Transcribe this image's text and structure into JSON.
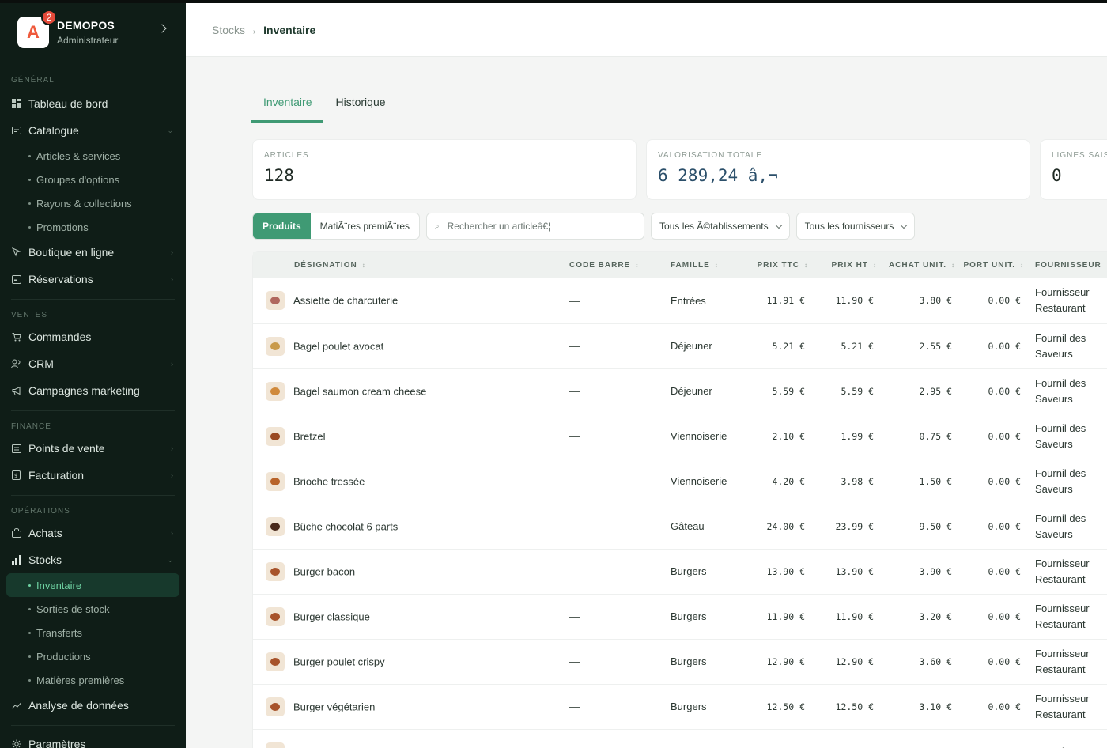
{
  "brand": {
    "letter": "A",
    "badge": "2",
    "name": "DEMOPOS",
    "role": "Administrateur"
  },
  "nav": {
    "general_title": "GÉNÉRAL",
    "dashboard": "Tableau de bord",
    "catalogue": "Catalogue",
    "catalogue_items": [
      "Articles & services",
      "Groupes d'options",
      "Rayons & collections",
      "Promotions"
    ],
    "boutique": "Boutique en ligne",
    "reservations": "Réservations",
    "ventes_title": "VENTES",
    "commandes": "Commandes",
    "crm": "CRM",
    "campagnes": "Campagnes marketing",
    "finance_title": "FINANCE",
    "points_vente": "Points de vente",
    "facturation": "Facturation",
    "operations_title": "OPÉRATIONS",
    "achats": "Achats",
    "stocks": "Stocks",
    "stocks_items": [
      "Inventaire",
      "Sorties de stock",
      "Transferts",
      "Productions",
      "Matières premières"
    ],
    "analyse": "Analyse de données",
    "parametres": "Paramètres"
  },
  "breadcrumb": {
    "parent": "Stocks",
    "separator": "›",
    "current": "Inventaire"
  },
  "tabs": [
    "Inventaire",
    "Historique"
  ],
  "cards": [
    {
      "label": "ARTICLES",
      "value": "128"
    },
    {
      "label": "VALORISATION TOTALE",
      "value": "6 289,24 â‚¬"
    },
    {
      "label": "LIGNES SAISIES",
      "value": "0"
    }
  ],
  "filters": {
    "seg_products": "Produits",
    "seg_raw": "MatiÃ¨res premiÃ¨res",
    "search_placeholder": "Rechercher un articleâ€¦",
    "establishments": "Tous les Ã©tablissements",
    "suppliers": "Tous les fournisseurs"
  },
  "table": {
    "headers": [
      "DÉSIGNATION",
      "CODE BARRE",
      "FAMILLE",
      "PRIX TTC",
      "PRIX HT",
      "ACHAT UNIT.",
      "PORT UNIT.",
      "FOURNISSEUR"
    ],
    "rows": [
      {
        "name": "Assiette de charcuterie",
        "barcode": "—",
        "family": "Entrées",
        "ttc": "11.91 €",
        "ht": "11.90 €",
        "achat": "3.80 €",
        "port": "0.00 €",
        "supplier": "Fournisseur Restaurant",
        "thumb": "#b0675d"
      },
      {
        "name": "Bagel poulet avocat",
        "barcode": "—",
        "family": "Déjeuner",
        "ttc": "5.21 €",
        "ht": "5.21 €",
        "achat": "2.55 €",
        "port": "0.00 €",
        "supplier": "Fournil des Saveurs",
        "thumb": "#c99a4a"
      },
      {
        "name": "Bagel saumon cream cheese",
        "barcode": "—",
        "family": "Déjeuner",
        "ttc": "5.59 €",
        "ht": "5.59 €",
        "achat": "2.95 €",
        "port": "0.00 €",
        "supplier": "Fournil des Saveurs",
        "thumb": "#d08a3c"
      },
      {
        "name": "Bretzel",
        "barcode": "—",
        "family": "Viennoiserie",
        "ttc": "2.10 €",
        "ht": "1.99 €",
        "achat": "0.75 €",
        "port": "0.00 €",
        "supplier": "Fournil des Saveurs",
        "thumb": "#9a4a22"
      },
      {
        "name": "Brioche tressée",
        "barcode": "—",
        "family": "Viennoiserie",
        "ttc": "4.20 €",
        "ht": "3.98 €",
        "achat": "1.50 €",
        "port": "0.00 €",
        "supplier": "Fournil des Saveurs",
        "thumb": "#b8632a"
      },
      {
        "name": "Bûche chocolat 6 parts",
        "barcode": "—",
        "family": "Gâteau",
        "ttc": "24.00 €",
        "ht": "23.99 €",
        "achat": "9.50 €",
        "port": "0.00 €",
        "supplier": "Fournil des Saveurs",
        "thumb": "#4a2a1c"
      },
      {
        "name": "Burger bacon",
        "barcode": "—",
        "family": "Burgers",
        "ttc": "13.90 €",
        "ht": "13.90 €",
        "achat": "3.90 €",
        "port": "0.00 €",
        "supplier": "Fournisseur Restaurant",
        "thumb": "#a7532b"
      },
      {
        "name": "Burger classique",
        "barcode": "—",
        "family": "Burgers",
        "ttc": "11.90 €",
        "ht": "11.90 €",
        "achat": "3.20 €",
        "port": "0.00 €",
        "supplier": "Fournisseur Restaurant",
        "thumb": "#a7532b"
      },
      {
        "name": "Burger poulet crispy",
        "barcode": "—",
        "family": "Burgers",
        "ttc": "12.90 €",
        "ht": "12.90 €",
        "achat": "3.60 €",
        "port": "0.00 €",
        "supplier": "Fournisseur Restaurant",
        "thumb": "#a7532b"
      },
      {
        "name": "Burger végétarien",
        "barcode": "—",
        "family": "Burgers",
        "ttc": "12.50 €",
        "ht": "12.50 €",
        "achat": "3.10 €",
        "port": "0.00 €",
        "supplier": "Fournisseur Restaurant",
        "thumb": "#a7532b"
      },
      {
        "name": "",
        "barcode": "",
        "family": "",
        "ttc": "",
        "ht": "",
        "achat": "",
        "port": "",
        "supplier": "Fournisseur",
        "thumb": "#a7532b"
      }
    ]
  },
  "colors": {
    "accent": "#3f9a74",
    "sidebar": "#0f1d17"
  }
}
